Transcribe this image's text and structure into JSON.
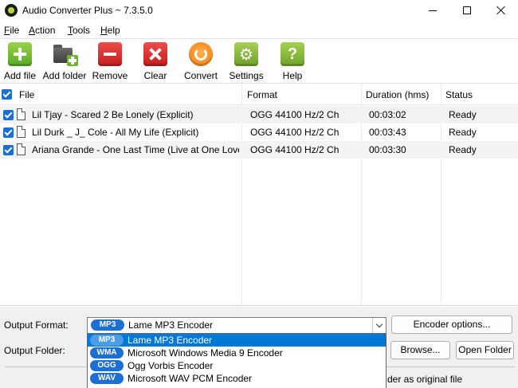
{
  "window": {
    "title": "Audio Converter Plus ~ 7.3.5.0"
  },
  "menu": [
    "File",
    "Action",
    "Tools",
    "Help"
  ],
  "toolbar": {
    "add_file": "Add file",
    "add_folder": "Add folder",
    "remove": "Remove",
    "clear": "Clear",
    "convert": "Convert",
    "settings": "Settings",
    "help": "Help",
    "help_glyph": "?",
    "settings_glyph": "⚙"
  },
  "list": {
    "columns": [
      "File",
      "Format",
      "Duration (hms)",
      "Status"
    ],
    "rows": [
      {
        "file": "Lil Tjay - Scared 2 Be Lonely (Explicit)",
        "format": "OGG 44100 Hz/2 Ch",
        "duration": "00:03:02",
        "status": "Ready",
        "checked": true
      },
      {
        "file": "Lil Durk _ J_ Cole - All My Life (Explicit)",
        "format": "OGG 44100 Hz/2 Ch",
        "duration": "00:03:43",
        "status": "Ready",
        "checked": true
      },
      {
        "file": "Ariana Grande - One Last Time (Live at One Love M...",
        "format": "OGG 44100 Hz/2 Ch",
        "duration": "00:03:30",
        "status": "Ready",
        "checked": true
      }
    ]
  },
  "output": {
    "format_label": "Output Format:",
    "folder_label": "Output Folder:",
    "selected_badge": "MP3",
    "selected_value": "Lame MP3 Encoder",
    "encoder_options": "Encoder options...",
    "browse": "Browse...",
    "open_folder": "Open Folder",
    "same_folder_text": "der as original file"
  },
  "dropdown": {
    "options": [
      {
        "badge": "MP3",
        "label": "Lame MP3 Encoder",
        "selected": true
      },
      {
        "badge": "WMA",
        "label": "Microsoft Windows Media 9 Encoder",
        "selected": false
      },
      {
        "badge": "OGG",
        "label": "Ogg Vorbis Encoder",
        "selected": false
      },
      {
        "badge": "WAV",
        "label": "Microsoft WAV PCM Encoder",
        "selected": false
      }
    ]
  }
}
